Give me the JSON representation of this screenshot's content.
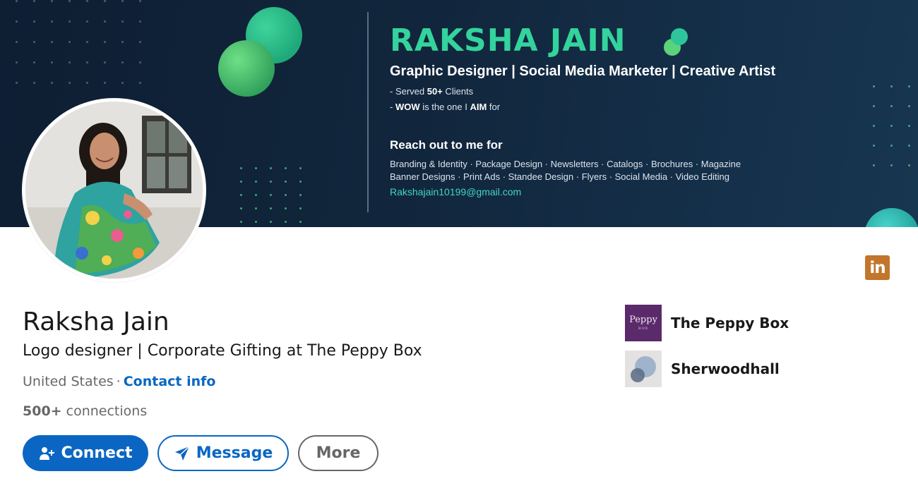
{
  "banner": {
    "name": "RAKSHA JAIN",
    "subtitle": "Graphic Designer | Social Media Marketer | Creative Artist",
    "line1_pre": "- Served ",
    "line1_bold": "50+",
    "line1_post": " Clients",
    "line2_pre": "- ",
    "line2_bold1": "WOW",
    "line2_mid": " is the one I ",
    "line2_bold2": "AIM",
    "line2_post": " for",
    "reach_title": "Reach out to me for",
    "services_line1": "Branding & Identity · Package Design · Newsletters · Catalogs · Brochures · Magazine",
    "services_line2": "Banner Designs · Print Ads · Standee Design · Flyers · Social Media · Video Editing",
    "email": "Rakshajain10199@gmail.com"
  },
  "profile": {
    "name": "Raksha Jain",
    "headline": "Logo designer | Corporate Gifting at The Peppy Box",
    "location": "United States",
    "separator": "·",
    "contact_info": "Contact info",
    "connections_count": "500+",
    "connections_label": " connections"
  },
  "actions": {
    "connect": "Connect",
    "message": "Message",
    "more": "More"
  },
  "companies": [
    {
      "name": "The Peppy Box",
      "logo_text": "Peppy",
      "logo_small": "BOX"
    },
    {
      "name": "Sherwoodhall"
    }
  ],
  "social_icon": {
    "name": "linkedin-icon",
    "text": "in"
  },
  "colors": {
    "brand_blue": "#0a66c2",
    "banner_accent": "#33d39c",
    "linkedin_icon_bg": "#c1762b",
    "peppy_logo_bg": "#5a2a6b"
  }
}
